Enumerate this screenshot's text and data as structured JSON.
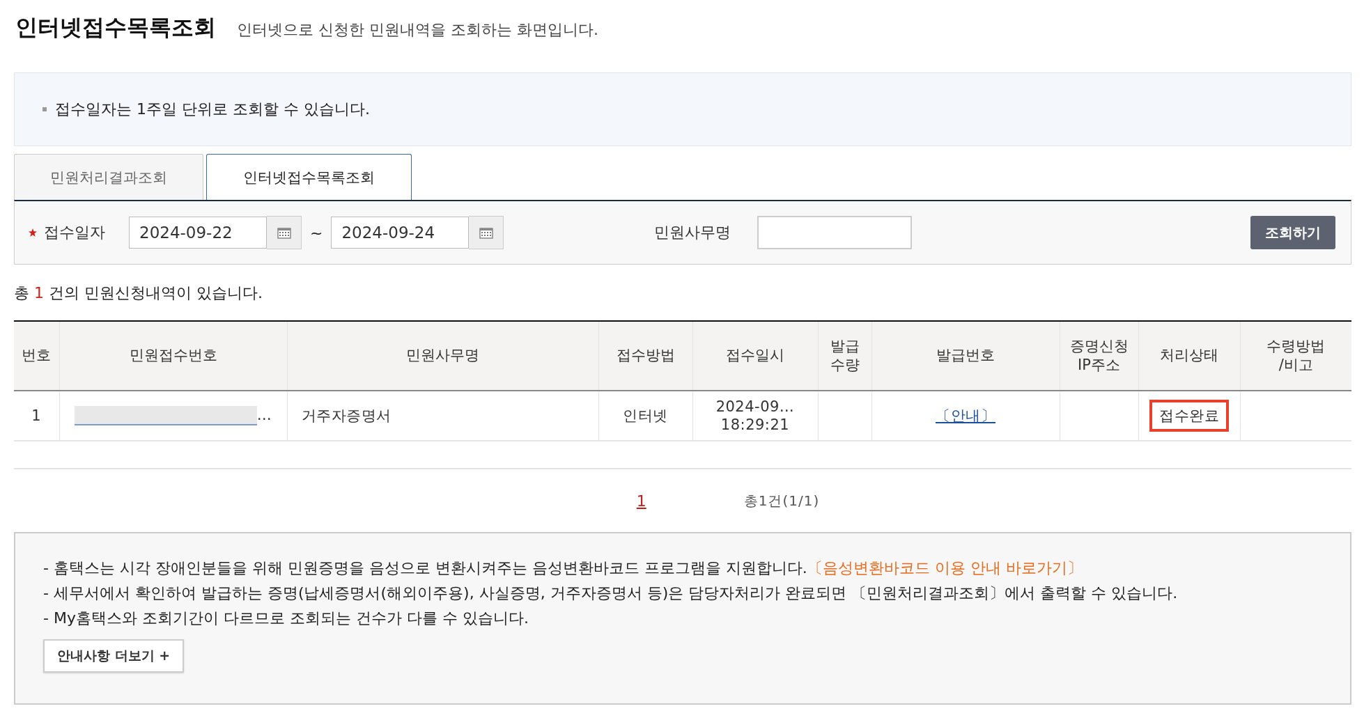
{
  "header": {
    "title": "인터넷접수목록조회",
    "subtitle": "인터넷으로 신청한 민원내역을 조회하는 화면입니다."
  },
  "notice": [
    "접수일자는 1주일 단위로 조회할 수 있습니다."
  ],
  "tabs": [
    {
      "label": "민원처리결과조회",
      "selected": false
    },
    {
      "label": "인터넷접수목록조회",
      "selected": true
    }
  ],
  "search": {
    "date_label": "접수일자",
    "required": true,
    "from": "2024-09-22",
    "separator": "~",
    "to": "2024-09-24",
    "name_label": "민원사무명",
    "button": "조회하기"
  },
  "summary": {
    "prefix": "총",
    "count": "1",
    "suffix": "건의 민원신청내역이 있습니다."
  },
  "table": {
    "columns": [
      "번호",
      "민원접수번호",
      "민원사무명",
      "접수방법",
      "접수일시",
      "발급\n수량",
      "발급번호",
      "증명신청\nIP주소",
      "처리상태",
      "수령방법\n/비고"
    ],
    "rows": [
      {
        "cells": [
          {
            "kind": "text",
            "text": "1"
          },
          {
            "kind": "redacted",
            "text": "…"
          },
          {
            "kind": "left-text",
            "text": "거주자증명서"
          },
          {
            "kind": "text",
            "text": "인터넷"
          },
          {
            "kind": "text",
            "text": "2024-09…\n18:29:21"
          },
          {
            "kind": "empty"
          },
          {
            "kind": "link",
            "text": "〔안내〕"
          },
          {
            "kind": "empty"
          },
          {
            "kind": "text",
            "text": "접수완료",
            "highlighted": true
          },
          {
            "kind": "empty"
          }
        ]
      }
    ]
  },
  "pagination": {
    "pages": [
      {
        "label": "1",
        "selected": true
      }
    ],
    "total": "총1건(1/1)"
  },
  "notes": {
    "lines": [
      {
        "text": "- 홈택스는 시각 장애인분들을 위해 민원증명을 음성으로 변환시켜주는 음성변환바코드 프로그램을 지원합니다.",
        "link": "〔음성변환바코드 이용 안내 바로가기〕"
      },
      {
        "text": "- 세무서에서 확인하여 발급하는 증명(납세증명서(해외이주용), 사실증명, 거주자증명서 등)은 담당자처리가 완료되면 〔민원처리결과조회〕에서 출력할 수 있습니다."
      },
      {
        "text": "- My홈택스와 조회기간이 다르므로 조회되는 건수가 다를 수 있습니다."
      }
    ],
    "more_button": "안내사항 더보기 +"
  }
}
